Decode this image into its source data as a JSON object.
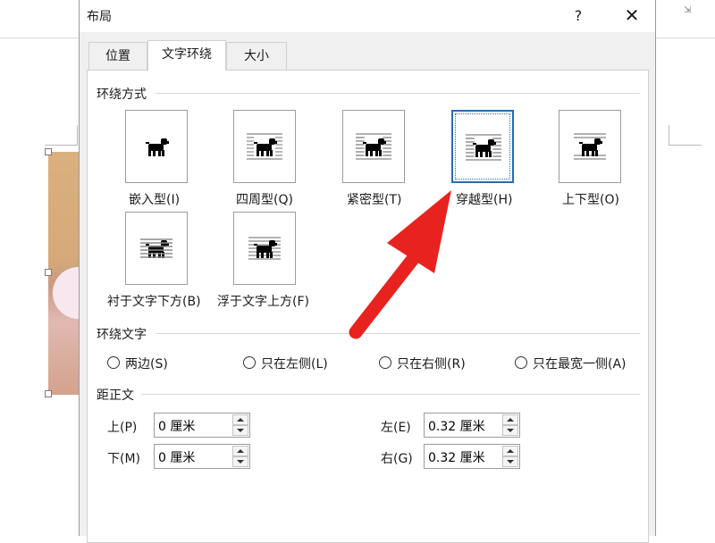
{
  "dialog": {
    "title": "布局",
    "help_label": "?",
    "close_label": "✕"
  },
  "tabs": [
    {
      "label": "位置",
      "active": false
    },
    {
      "label": "文字环绕",
      "active": true
    },
    {
      "label": "大小",
      "active": false
    }
  ],
  "wrap_style": {
    "heading": "环绕方式",
    "options": [
      {
        "label": "嵌入型(I)",
        "selected": false
      },
      {
        "label": "四周型(Q)",
        "selected": false
      },
      {
        "label": "紧密型(T)",
        "selected": false
      },
      {
        "label": "穿越型(H)",
        "selected": true
      },
      {
        "label": "上下型(O)",
        "selected": false
      },
      {
        "label": "衬于文字下方(B)",
        "selected": false
      },
      {
        "label": "浮于文字上方(F)",
        "selected": false
      }
    ]
  },
  "wrap_text": {
    "heading": "环绕文字",
    "options": [
      "两边(S)",
      "只在左侧(L)",
      "只在右侧(R)",
      "只在最宽一侧(A)"
    ]
  },
  "distance": {
    "heading": "距正文",
    "top": {
      "label": "上(P)",
      "value": "0 厘米"
    },
    "bottom": {
      "label": "下(M)",
      "value": "0 厘米"
    },
    "left": {
      "label": "左(E)",
      "value": "0.32 厘米"
    },
    "right": {
      "label": "右(G)",
      "value": "0.32 厘米"
    }
  },
  "colors": {
    "annotation_arrow": "#e8231f",
    "selection_blue": "#2b6cb0"
  },
  "icons": {
    "preview": "dog-silhouette-icon",
    "annotation": "red-arrow-icon"
  }
}
